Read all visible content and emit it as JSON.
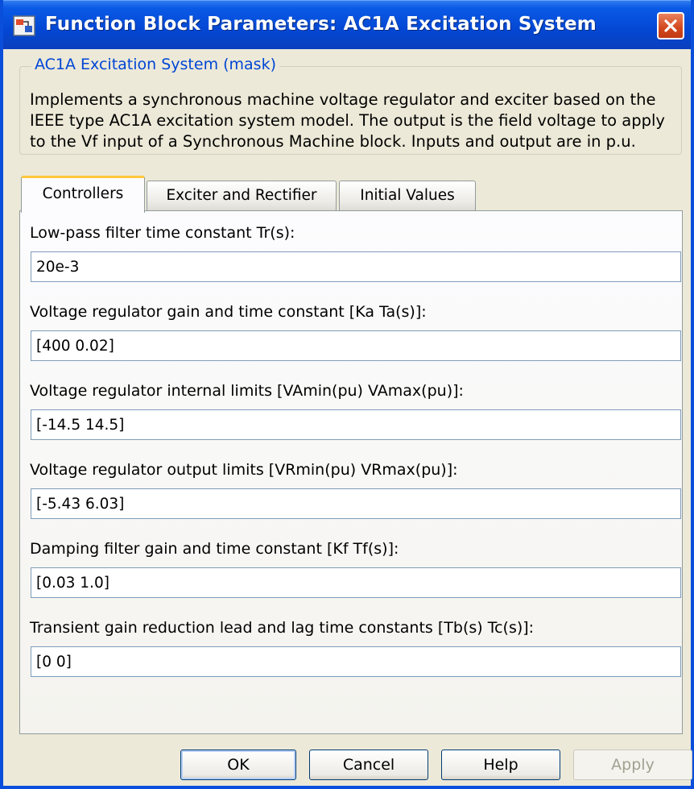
{
  "window": {
    "title": "Function Block Parameters: AC1A Excitation System",
    "icon": "simulink-block-icon",
    "close_icon": "close-icon"
  },
  "group": {
    "legend": "AC1A Excitation System (mask)",
    "description": "Implements a synchronous machine voltage regulator and exciter based on the IEEE type AC1A excitation system model. The output is the field voltage to apply to the Vf input of a Synchronous Machine block. Inputs and output are in p.u."
  },
  "tabs": [
    {
      "label": "Controllers",
      "active": true
    },
    {
      "label": "Exciter and Rectifier",
      "active": false
    },
    {
      "label": "Initial Values",
      "active": false
    }
  ],
  "params": [
    {
      "label": "Low-pass filter time constant Tr(s):",
      "value": "20e-3"
    },
    {
      "label": "Voltage regulator gain and time constant [Ka Ta(s)]:",
      "value": "[400 0.02]"
    },
    {
      "label": "Voltage regulator internal limits [VAmin(pu) VAmax(pu)]:",
      "value": "[-14.5 14.5]"
    },
    {
      "label": "Voltage regulator output limits [VRmin(pu) VRmax(pu)]:",
      "value": "[-5.43 6.03]"
    },
    {
      "label": "Damping filter gain and time constant [Kf Tf(s)]:",
      "value": "[0.03 1.0]"
    },
    {
      "label": "Transient gain reduction lead and lag time constants [Tb(s) Tc(s)]:",
      "value": "[0 0]"
    }
  ],
  "buttons": {
    "ok": "OK",
    "cancel": "Cancel",
    "help": "Help",
    "apply": "Apply"
  },
  "colors": {
    "title_bar": "#0a5ae6",
    "legend": "#0046d5",
    "active_tab_accent": "#ffc83c"
  }
}
